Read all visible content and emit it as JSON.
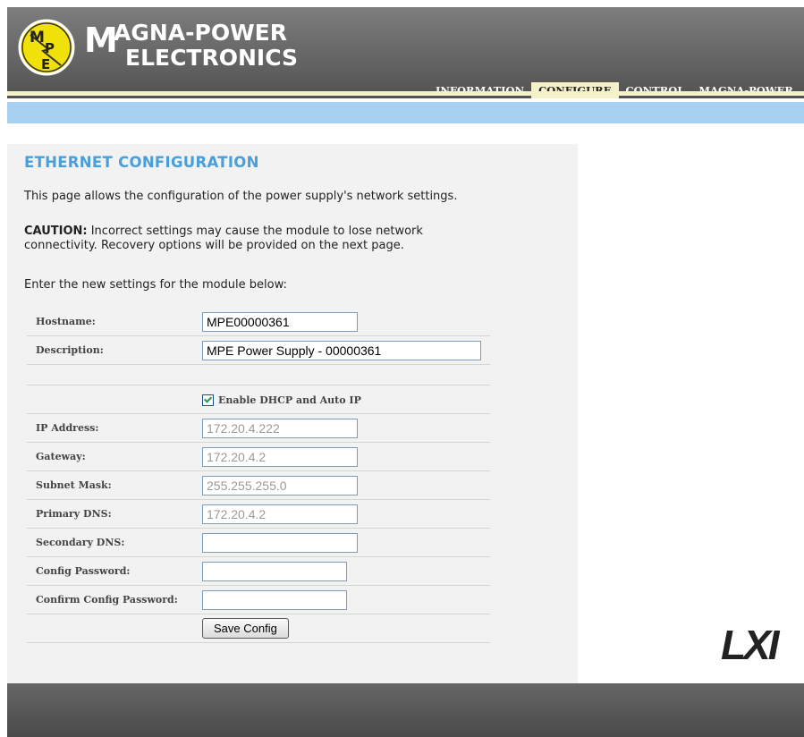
{
  "brand": {
    "initial": "M",
    "line1": "AGNA-POWER",
    "line2": "ELECTRONICS",
    "logo_letters": [
      "M",
      "P",
      "E"
    ]
  },
  "nav": [
    {
      "label": "INFORMATION",
      "active": false
    },
    {
      "label": "CONFIGURE",
      "active": true
    },
    {
      "label": "CONTROL",
      "active": false
    },
    {
      "label": "MAGNA-POWER",
      "active": false
    }
  ],
  "page": {
    "title": "ETHERNET CONFIGURATION",
    "intro": "This page allows the configuration of the power supply's network settings.",
    "caution_label": "CAUTION:",
    "caution_text": " Incorrect settings may cause the module to lose network connectivity. Recovery options will be provided on the next page.",
    "instruction": "Enter the new settings for the module below:"
  },
  "form": {
    "hostname": {
      "label": "Hostname:",
      "value": "MPE00000361"
    },
    "description": {
      "label": "Description:",
      "value": "MPE Power Supply - 00000361"
    },
    "dhcp": {
      "label": "Enable DHCP and Auto IP",
      "checked": true
    },
    "ip": {
      "label": "IP Address:",
      "value": "172.20.4.222"
    },
    "gateway": {
      "label": "Gateway:",
      "value": "172.20.4.2"
    },
    "subnet": {
      "label": "Subnet Mask:",
      "value": "255.255.255.0"
    },
    "dns1": {
      "label": "Primary DNS:",
      "value": "172.20.4.2"
    },
    "dns2": {
      "label": "Secondary DNS:",
      "value": ""
    },
    "pw": {
      "label": "Config Password:",
      "value": ""
    },
    "pw2": {
      "label": "Confirm Config Password:",
      "value": ""
    },
    "save_label": "Save Config"
  },
  "lxi_logo": "LXI",
  "colors": {
    "accent_blue": "#4a9fd8",
    "nav_active_bg": "#f5f1c8",
    "band_blue": "#a8d0f0"
  }
}
